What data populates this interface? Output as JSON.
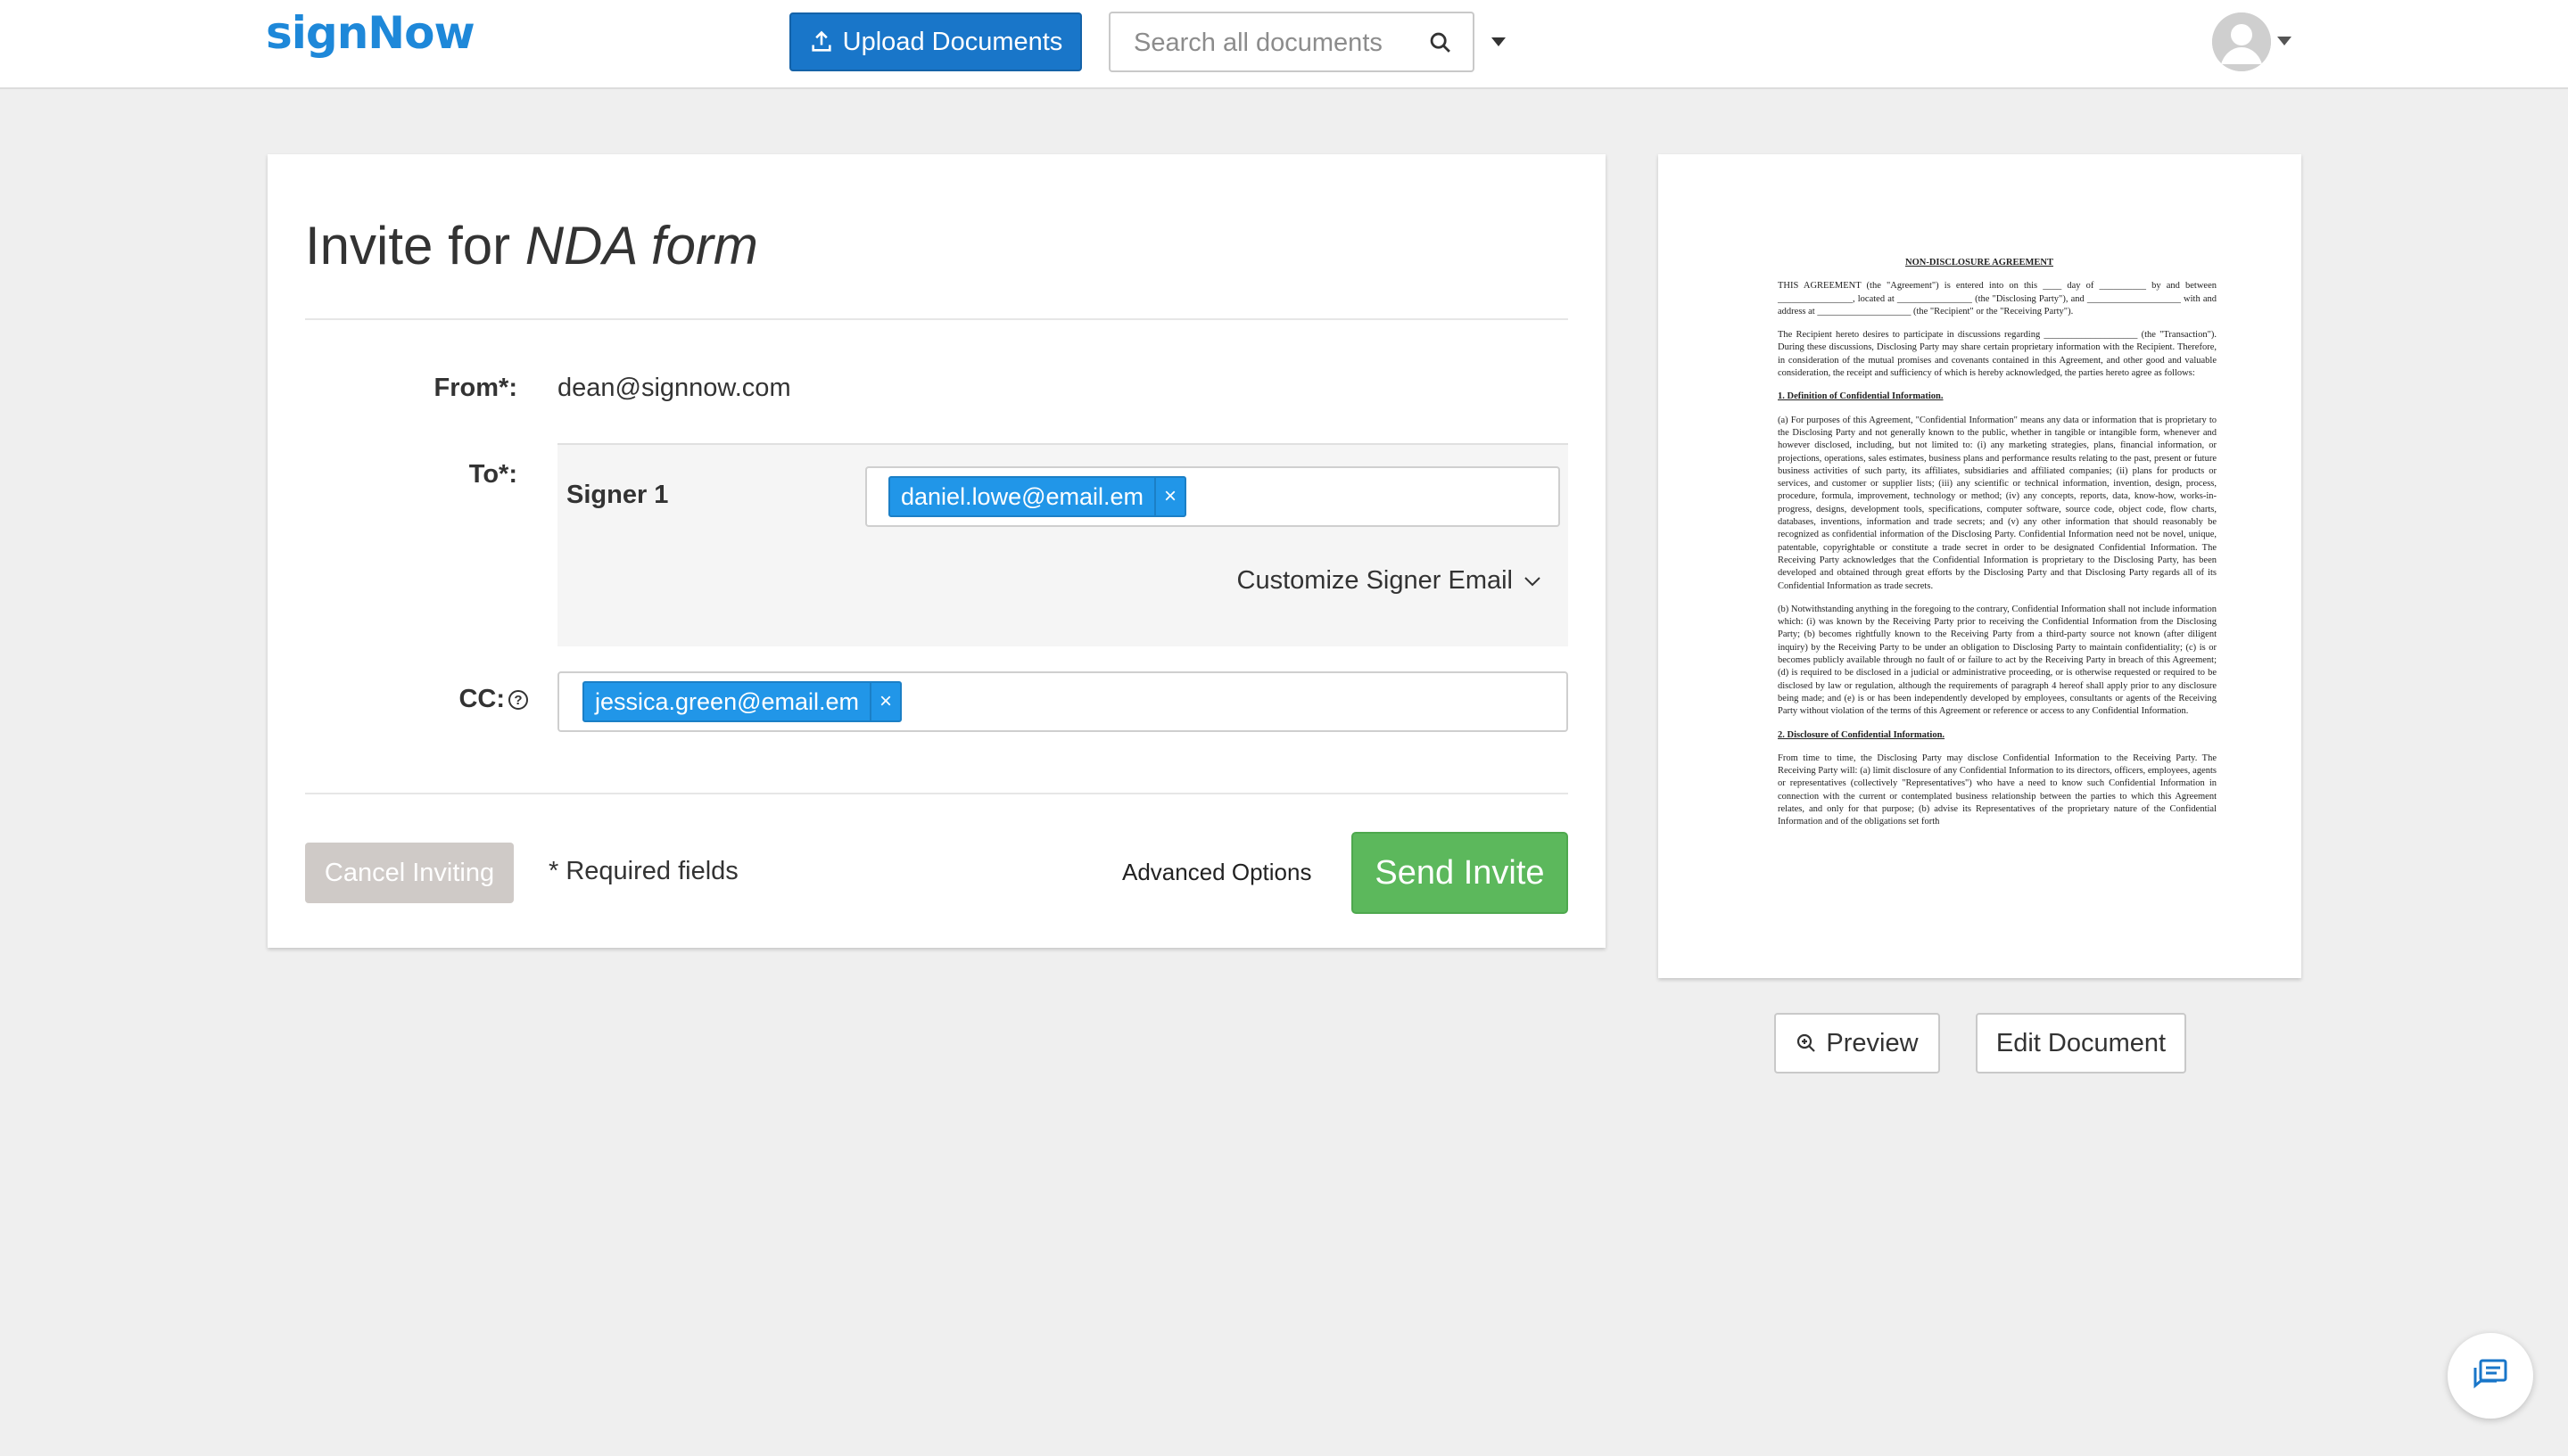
{
  "header": {
    "logo": "signNow",
    "upload_label": "Upload Documents",
    "search_placeholder": "Search all documents",
    "icons": {
      "upload": "upload-icon",
      "search": "search-icon",
      "avatar": "user-avatar-icon",
      "chat": "chat-icon"
    },
    "accent_color": "#1976c9"
  },
  "invite": {
    "title_prefix": "Invite for ",
    "document_name": "NDA form",
    "from_label": "From*:",
    "from_value": "dean@signnow.com",
    "to_label": "To*:",
    "signer_label": "Signer 1",
    "signer_email": "daniel.lowe@email.em",
    "customize_label": "Customize Signer Email",
    "cc_label": "CC:",
    "cc_email": "jessica.green@email.em",
    "remove_symbol": "×",
    "help_symbol": "?",
    "cancel_label": "Cancel Inviting",
    "required_label": "* Required fields",
    "advanced_label": "Advanced Options",
    "send_label": "Send Invite",
    "send_color": "#5cb85c"
  },
  "document": {
    "title": "NON-DISCLOSURE AGREEMENT",
    "para1": "THIS AGREEMENT (the \"Agreement\") is entered into on this ____ day of __________ by and between ________________, located at ________________ (the \"Disclosing Party\"), and ____________________ with and address at ____________________ (the \"Recipient\" or the \"Receiving Party\").",
    "para2": "The Recipient hereto desires to participate in discussions regarding ____________________ (the \"Transaction\"). During these discussions, Disclosing Party may share certain proprietary information with the Recipient. Therefore, in consideration of the mutual promises and covenants contained in this Agreement, and other good and valuable consideration, the receipt and sufficiency of which is hereby acknowledged, the parties hereto agree as follows:",
    "head1": "1.      Definition of Confidential Information.",
    "para3": "(a)      For purposes of this Agreement, \"Confidential Information\" means any data or information that is proprietary to the Disclosing Party and not generally known to the public, whether in tangible or intangible form, whenever and however disclosed, including, but not limited to: (i) any marketing strategies, plans, financial information, or projections, operations, sales estimates, business plans and performance results relating to the past, present or future business activities of such party, its affiliates, subsidiaries and affiliated companies; (ii) plans for products or services, and customer or supplier lists; (iii) any scientific or technical information, invention, design, process, procedure, formula, improvement, technology or method; (iv) any concepts, reports, data, know-how, works-in-progress, designs, development tools, specifications, computer software, source code, object code, flow charts, databases, inventions, information and trade secrets; and (v) any other information that should reasonably be recognized as confidential information of the Disclosing Party. Confidential Information need not be novel, unique, patentable, copyrightable or constitute a trade secret in order to be designated Confidential Information. The Receiving Party acknowledges that the Confidential Information is proprietary to the Disclosing Party, has been developed and obtained through great efforts by the Disclosing Party and that Disclosing Party regards all of its Confidential Information as trade secrets.",
    "para4": "(b)      Notwithstanding anything in the foregoing to the contrary, Confidential Information shall not include information which: (i) was known by the Receiving Party prior to receiving the Confidential Information from the Disclosing Party; (b) becomes rightfully known to the Receiving Party from a third-party source not known (after diligent inquiry) by the Receiving Party to be under an obligation to Disclosing Party to maintain confidentiality; (c) is or becomes publicly available through no fault of or failure to act by the Receiving Party in breach of this Agreement; (d) is required to be disclosed in a judicial or administrative proceeding, or is otherwise requested or required to be disclosed by law or regulation, although the requirements of paragraph 4 hereof shall apply prior to any disclosure being made; and (e) is or has been independently developed by employees, consultants or agents of the Receiving Party without violation of the terms of this Agreement or reference or access to any Confidential Information.",
    "head2": "2.      Disclosure of Confidential Information.",
    "para5": "From time to time, the Disclosing Party may disclose Confidential Information to the Receiving Party. The Receiving Party will: (a) limit disclosure of any Confidential Information to its directors, officers, employees, agents or representatives (collectively \"Representatives\") who have a need to know such Confidential Information in connection with the current or contemplated business relationship between the parties to which this Agreement relates, and only for that purpose; (b) advise its Representatives of the proprietary nature of the Confidential Information and of the obligations set forth",
    "preview_label": "Preview",
    "edit_label": "Edit Document"
  }
}
